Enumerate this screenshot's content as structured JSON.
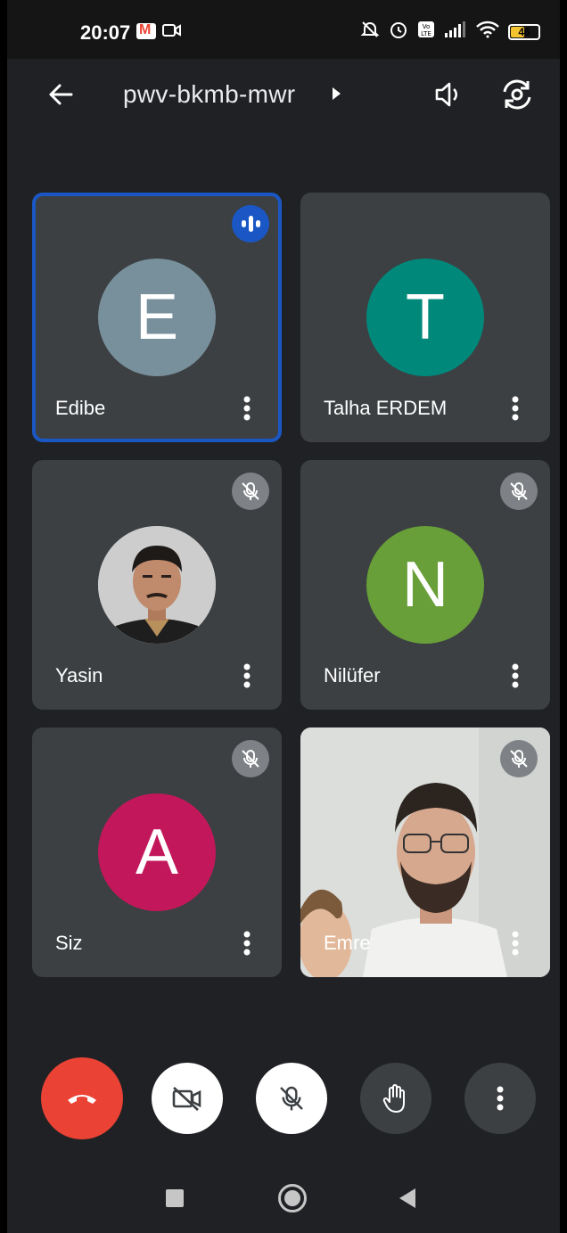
{
  "status_bar": {
    "time": "20:07",
    "battery_level": "46"
  },
  "app_bar": {
    "meeting_code": "pwv-bkmb-mwr",
    "icons": [
      "back-arrow-icon",
      "caret-right-icon",
      "speaker-icon",
      "flip-camera-icon"
    ]
  },
  "participants": [
    {
      "name": "Edibe",
      "initial": "E",
      "avatar_color": "#78909c",
      "state": "speaking"
    },
    {
      "name": "Talha ERDEM",
      "initial": "T",
      "avatar_color": "#00897b",
      "state": "unmuted"
    },
    {
      "name": "Yasin",
      "initial": "",
      "avatar_color": "#cfcfcf",
      "state": "muted",
      "avatar_type": "photo"
    },
    {
      "name": "Nilüfer",
      "initial": "N",
      "avatar_color": "#689f38",
      "state": "muted"
    },
    {
      "name": "Siz",
      "initial": "A",
      "avatar_color": "#c2185b",
      "state": "muted"
    },
    {
      "name": "Emre",
      "initial": "",
      "avatar_color": "",
      "state": "muted",
      "avatar_type": "video"
    }
  ],
  "controls": {
    "end_call_color": "#ea4335",
    "icons": [
      "end-call-icon",
      "camera-off-icon",
      "mic-off-icon",
      "raise-hand-icon",
      "more-vertical-icon"
    ]
  },
  "colors": {
    "background": "#202124",
    "tile": "#3c4043",
    "active_border": "#1a57c4"
  }
}
